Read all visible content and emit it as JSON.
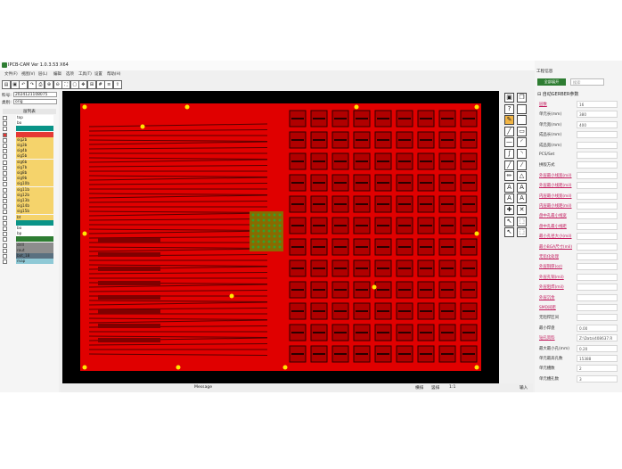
{
  "app": {
    "title": "IPCB-CAM Ver 1.0.3.53 X64"
  },
  "window_controls": {
    "minimize": "—",
    "maximize": "☐",
    "close": "✕"
  },
  "menu": [
    "文件(F)",
    "视图(V)",
    "层(L)",
    "编辑",
    "选项",
    "工具(T)",
    "设置",
    "帮助(H)"
  ],
  "toolbar_icons": [
    "open-icon",
    "save-icon",
    "undo-icon",
    "redo-icon",
    "print-icon",
    "zoom-in-icon",
    "zoom-out-icon",
    "zoom-fit-icon",
    "zoom-area-icon",
    "pan-icon",
    "measure-icon",
    "grid-icon",
    "layer-icon",
    "export-icon"
  ],
  "left": {
    "job_label": "料号:",
    "job_value": "2024121108075",
    "step_label": "类别:",
    "step_value": "orig",
    "layers_header": "层列表",
    "layers": [
      {
        "name": "top",
        "color": "#ffffff"
      },
      {
        "name": "bo",
        "color": "#ffffff"
      },
      {
        "name": "",
        "color": "#0a9488"
      },
      {
        "name": "",
        "color": "#e53935"
      },
      {
        "name": "sig2b",
        "color": "#f5d36b"
      },
      {
        "name": "sig3b",
        "color": "#f5d36b"
      },
      {
        "name": "sig4b",
        "color": "#f5d36b"
      },
      {
        "name": "sig5b",
        "color": "#f5d36b"
      },
      {
        "name": "sig6b",
        "color": "#f5d36b"
      },
      {
        "name": "sig7b",
        "color": "#f5d36b"
      },
      {
        "name": "sig8b",
        "color": "#f5d36b"
      },
      {
        "name": "sig9b",
        "color": "#f5d36b"
      },
      {
        "name": "sig10b",
        "color": "#f5d36b"
      },
      {
        "name": "sig11b",
        "color": "#f5d36b"
      },
      {
        "name": "sig12b",
        "color": "#f5d36b"
      },
      {
        "name": "sig13b",
        "color": "#f5d36b"
      },
      {
        "name": "sig14b",
        "color": "#f5d36b"
      },
      {
        "name": "sig15b",
        "color": "#f5d36b"
      },
      {
        "name": "bt",
        "color": "#f5d36b"
      },
      {
        "name": "",
        "color": "#0a9488"
      },
      {
        "name": "bo",
        "color": "#ffffff"
      },
      {
        "name": "bp",
        "color": "#ffffff"
      },
      {
        "name": "",
        "color": "#2e7d32"
      },
      {
        "name": "drill",
        "color": "#8d8d8d"
      },
      {
        "name": "rout",
        "color": "#8d8d8d"
      },
      {
        "name": "bot_18",
        "color": "#5a7080"
      },
      {
        "name": "map",
        "color": "#8fc9d6"
      }
    ]
  },
  "statusbar": {
    "message": "Message",
    "coords": "1:1",
    "btn1": "横排",
    "btn2": "竖排",
    "btn3": "输入"
  },
  "tools": [
    "save-icon",
    "copy-icon",
    "help-icon",
    "blank-icon",
    "edit-icon",
    "blank-icon",
    "line-icon",
    "rect-icon",
    "dash-icon",
    "arc-icon",
    "curve-icon",
    "arc2-icon",
    "line2-icon",
    "slash-icon",
    "pencil-icon",
    "triangle-icon",
    "a-icon",
    "a2-icon",
    "a3-icon",
    "a4-icon",
    "cross-icon",
    "x-icon",
    "move-icon",
    "select-icon",
    "move2-icon",
    "select2-icon"
  ],
  "right": {
    "header": "工程信息",
    "button": "全部展开",
    "search_placeholder": "搜索",
    "section_title": "⊟ 自动GERBER参数",
    "params": [
      {
        "label": "层数",
        "value": "16",
        "link": true
      },
      {
        "label": "单元长(mm)",
        "value": "380",
        "link": false
      },
      {
        "label": "单元宽(mm)",
        "value": "400",
        "link": false
      },
      {
        "label": "成品长(mm)",
        "value": "",
        "link": false
      },
      {
        "label": "成品宽(mm)",
        "value": "",
        "link": false
      },
      {
        "label": "PCS/Set",
        "value": "",
        "link": false
      },
      {
        "label": "拼版方式",
        "value": "",
        "link": false
      },
      {
        "label": "外层最小线宽(mil)",
        "value": "",
        "link": true
      },
      {
        "label": "外层最小线距(mil)",
        "value": "",
        "link": true
      },
      {
        "label": "内层最小线宽(mil)",
        "value": "",
        "link": true
      },
      {
        "label": "内层最小线距(mil)",
        "value": "",
        "link": true
      },
      {
        "label": "盘中孔最小线宽",
        "value": "",
        "link": true
      },
      {
        "label": "盘中孔最小线距",
        "value": "",
        "link": true
      },
      {
        "label": "最小孔径大小(mil)",
        "value": "",
        "link": true
      },
      {
        "label": "最小BGA尺寸(mil)",
        "value": "",
        "link": true
      },
      {
        "label": "无铅化处理",
        "value": "",
        "link": true
      },
      {
        "label": "外层铜厚(oz)",
        "value": "",
        "link": true
      },
      {
        "label": "外层孔铜(mil)",
        "value": "",
        "link": true
      },
      {
        "label": "外层阻焊(mil)",
        "value": "",
        "link": true
      },
      {
        "label": "外层沉金",
        "value": "",
        "link": true
      },
      {
        "label": "SMD间距",
        "value": "",
        "link": true
      },
      {
        "label": "无阻焊区间",
        "value": "",
        "link": false
      },
      {
        "label": "最小焊盘",
        "value": "0.00",
        "link": false
      },
      {
        "label": "钻孔资料",
        "value": "Z:\\Data\\408637.R",
        "link": true
      },
      {
        "label": "最大最小孔(mm)",
        "value": "0.20",
        "link": false
      },
      {
        "label": "单元最高孔数",
        "value": "15388",
        "link": false
      },
      {
        "label": "单元槽数",
        "value": "2",
        "link": false
      },
      {
        "label": "单元槽孔数",
        "value": "3",
        "link": false
      }
    ]
  },
  "colors": {
    "copper": "#e00000",
    "board_bg": "#000000",
    "pad": "#ffe600",
    "accent": "#2e7d32"
  }
}
